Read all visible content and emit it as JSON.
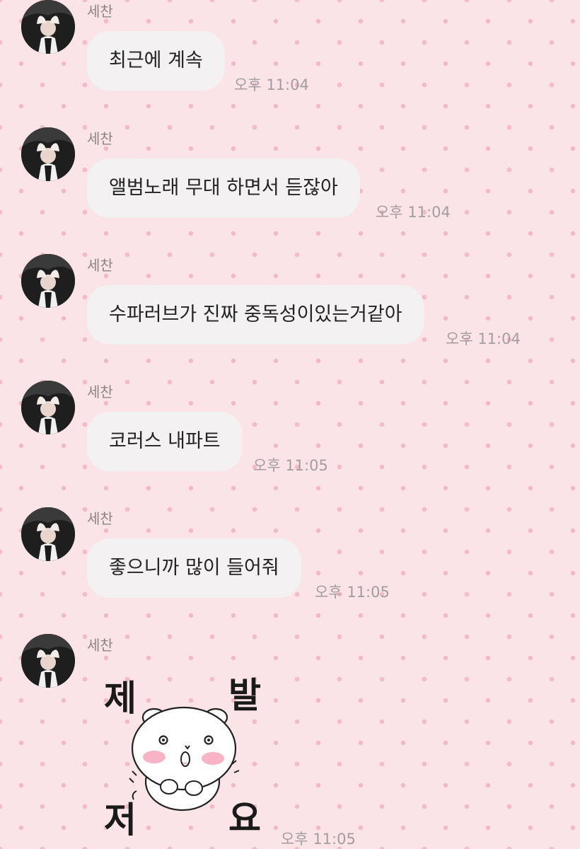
{
  "chat": {
    "messages": [
      {
        "sender": "세찬",
        "text": "최근에 계속",
        "time": "오후 11:04"
      },
      {
        "sender": "세찬",
        "text": "앨범노래 무대 하면서 듣잖아",
        "time": "오후 11:04"
      },
      {
        "sender": "세찬",
        "text": "수파러브가 진짜 중독성이있는거같아",
        "time": "오후 11:04"
      },
      {
        "sender": "세찬",
        "text": "코러스 내파트",
        "time": "오후 11:05"
      },
      {
        "sender": "세찬",
        "text": "좋으니까 많이 들어줘",
        "time": "오후 11:05"
      }
    ],
    "sticker_message": {
      "sender": "세찬",
      "sticker_text": [
        "제",
        "발",
        "저",
        "요"
      ],
      "time": "오후 11:05"
    }
  },
  "colors": {
    "background": "#fbe4e8",
    "polka_dot": "#f1bcc8",
    "bubble": "#f3f1f2",
    "timestamp": "#a39ca0",
    "sender_name": "#8c8484"
  },
  "icons": {
    "avatar": "profile-photo",
    "sticker": "white-hamster-please-sticker"
  }
}
